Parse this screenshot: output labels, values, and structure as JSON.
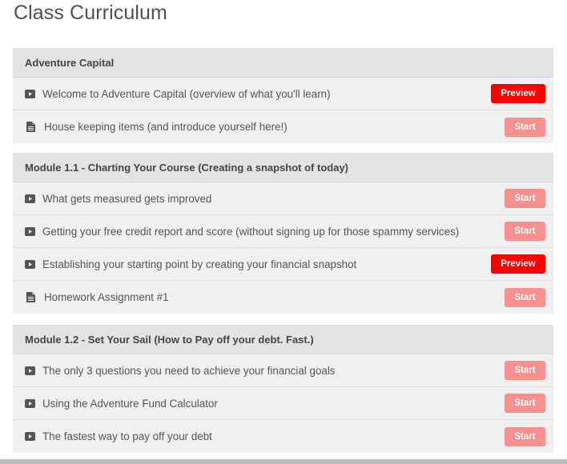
{
  "page_title": "Class Curriculum",
  "colors": {
    "preview": "#ff0000",
    "start": "#f99090",
    "header_bg": "#e3e3e3",
    "row_bg": "#f0f0f0"
  },
  "sections": [
    {
      "title": "Adventure Capital",
      "lectures": [
        {
          "icon": "video-icon",
          "title": "Welcome to Adventure Capital (overview of what you'll learn)",
          "button": "Preview"
        },
        {
          "icon": "document-icon",
          "title": "House keeping items (and introduce yourself here!)",
          "button": "Start"
        }
      ]
    },
    {
      "title": "Module 1.1 - Charting Your Course (Creating a snapshot of today)",
      "lectures": [
        {
          "icon": "video-icon",
          "title": "What gets measured gets improved",
          "button": "Start"
        },
        {
          "icon": "video-icon",
          "title": "Getting your free credit report and score (without signing up for those spammy services)",
          "button": "Start"
        },
        {
          "icon": "video-icon",
          "title": "Establishing your starting point by creating your financial snapshot",
          "button": "Preview"
        },
        {
          "icon": "document-icon",
          "title": "Homework Assignment #1",
          "button": "Start"
        }
      ]
    },
    {
      "title": "Module 1.2 - Set Your Sail (How to Pay off your debt. Fast.)",
      "lectures": [
        {
          "icon": "video-icon",
          "title": "The only 3 questions you need to achieve your financial goals",
          "button": "Start"
        },
        {
          "icon": "video-icon",
          "title": "Using the Adventure Fund Calculator",
          "button": "Start"
        },
        {
          "icon": "video-icon",
          "title": "The fastest way to pay off your debt",
          "button": "Start"
        }
      ]
    }
  ]
}
